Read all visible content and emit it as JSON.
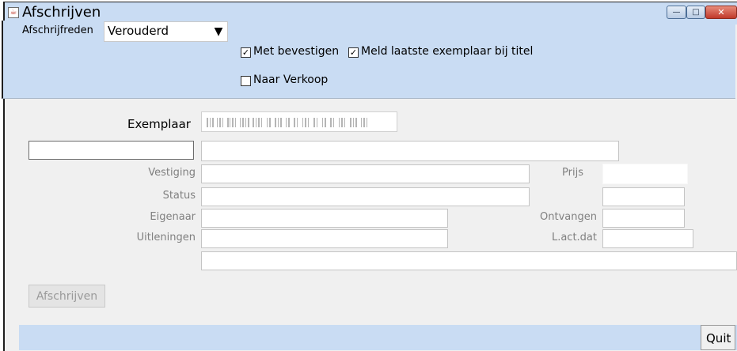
{
  "window": {
    "title": "Afschrijven",
    "icon": "java-cup-icon",
    "controls": {
      "minimize": "—",
      "maximize": "□",
      "close": "✕"
    }
  },
  "toolbar": {
    "reason_label": "Afschrijfreden",
    "reason_value": "Verouderd",
    "met_bevestigen": {
      "label": "Met bevestigen",
      "checked": true
    },
    "meld_laatste": {
      "label": "Meld laatste exemplaar bij titel",
      "checked": true
    },
    "naar_verkoop": {
      "label": "Naar Verkoop",
      "checked": false
    }
  },
  "form": {
    "exemplaar_label": "Exemplaar",
    "exemplaar_value": "",
    "vestiging_label": "Vestiging",
    "status_label": "Status",
    "eigenaar_label": "Eigenaar",
    "uitleningen_label": "Uitleningen",
    "prijs_label": "Prijs",
    "ontvangen_label": "Ontvangen",
    "lactdat_label": "L.act.dat"
  },
  "buttons": {
    "afschrijven": "Afschrijven",
    "quit": "Quit"
  },
  "colors": {
    "panel": "#c9dcf3",
    "body": "#f0f0f0",
    "close": "#c0392b"
  }
}
